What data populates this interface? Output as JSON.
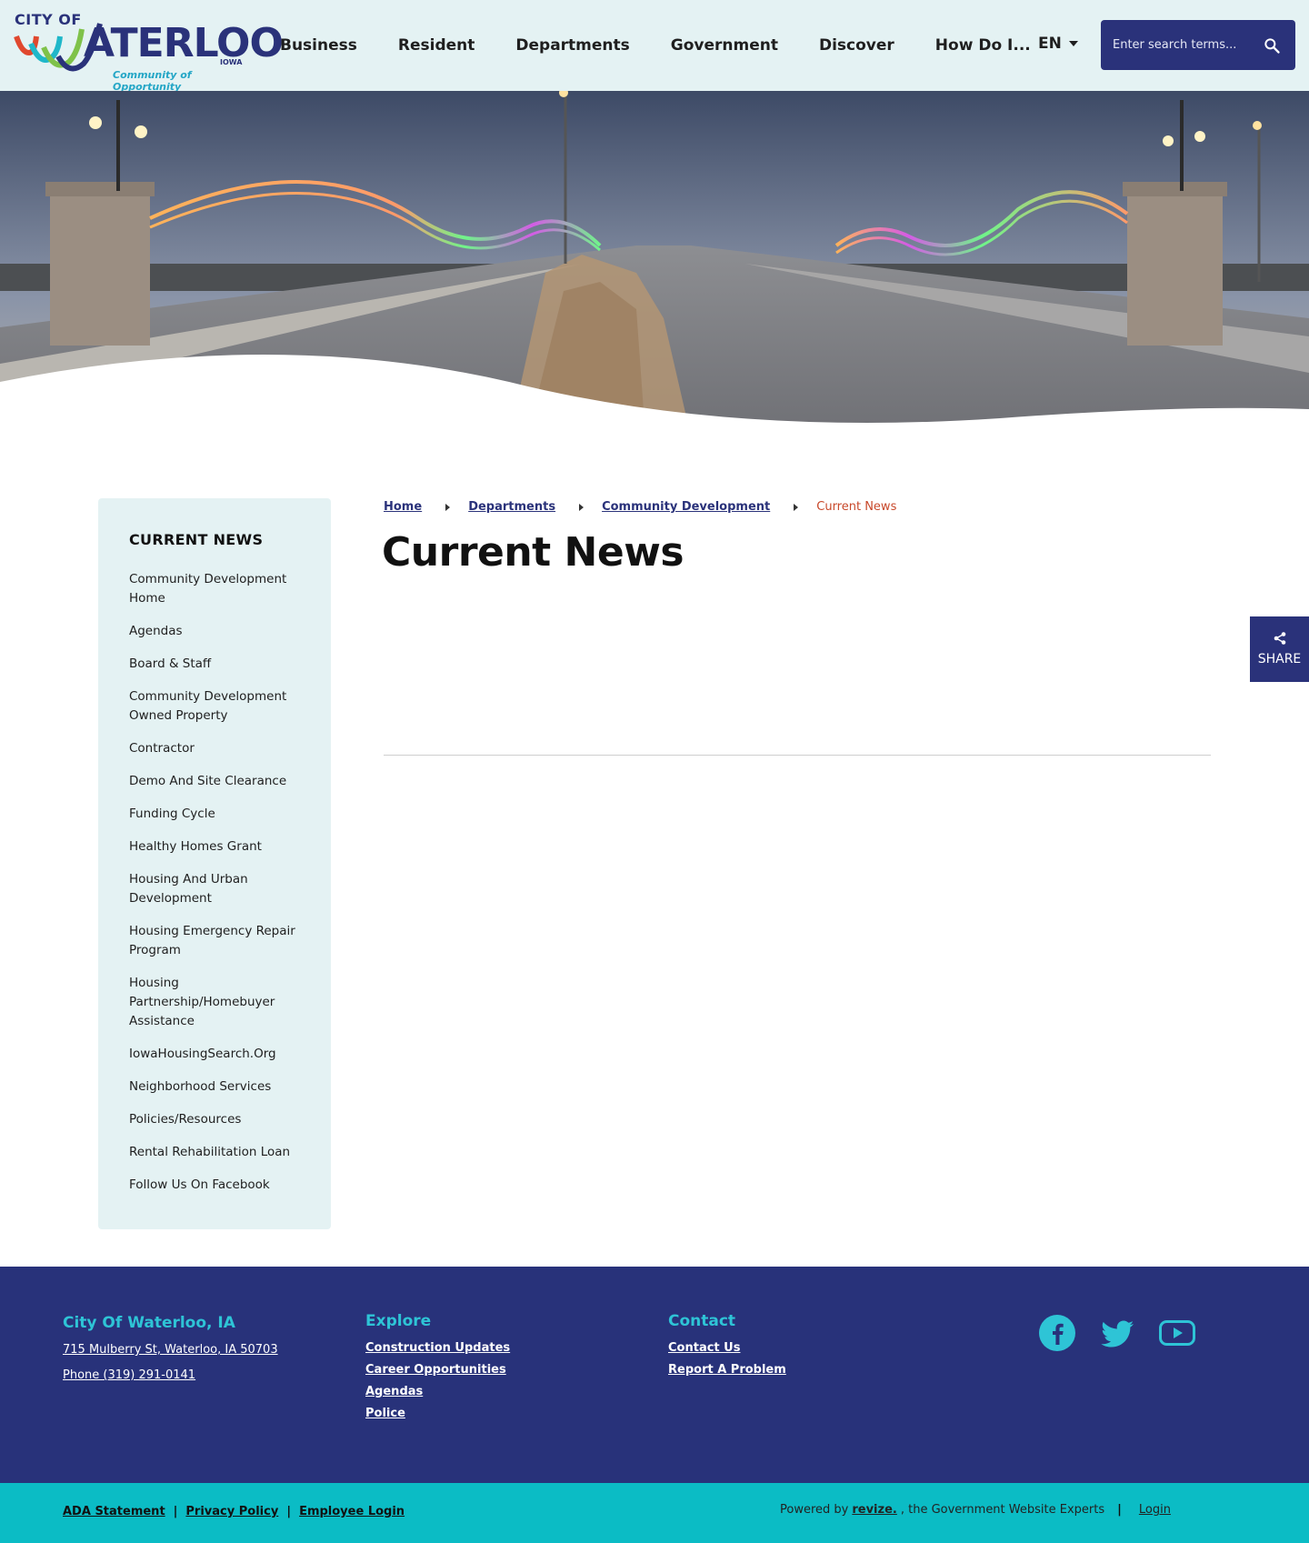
{
  "header": {
    "logo": {
      "city_of": "CITY OF",
      "word": "ATERLOO",
      "state": "IOWA",
      "tagline": "Community of Opportunity"
    },
    "nav": [
      "Business",
      "Resident",
      "Departments",
      "Government",
      "Discover",
      "How Do I..."
    ],
    "language": "EN",
    "search_placeholder": "Enter search terms...",
    "colors": {
      "header_bg": "#e4f2f3",
      "brand_navy": "#2a327a",
      "accent_teal": "#0bbcc5"
    }
  },
  "breadcrumb": {
    "links": [
      "Home",
      "Departments",
      "Community Development"
    ],
    "current": "Current News"
  },
  "page_title": "Current News",
  "sidebar": {
    "title": "CURRENT NEWS",
    "items": [
      "Community Development Home",
      "Agendas",
      "Board & Staff",
      "Community Development Owned Property",
      "Contractor",
      "Demo And Site Clearance",
      "Funding Cycle",
      "Healthy Homes Grant",
      "Housing And Urban Development",
      "Housing Emergency Repair Program",
      "Housing Partnership/Homebuyer Assistance",
      "IowaHousingSearch.Org",
      "Neighborhood Services",
      "Policies/Resources",
      "Rental Rehabilitation Loan",
      "Follow Us On Facebook"
    ]
  },
  "share": {
    "label": "SHARE",
    "icon": "share-icon"
  },
  "footer": {
    "city": {
      "title": "City Of Waterloo, IA",
      "address": "715 Mulberry St, Waterloo, IA 50703",
      "phone": "Phone (319) 291-0141"
    },
    "explore": {
      "title": "Explore",
      "links": [
        "Construction Updates",
        "Career Opportunities",
        "Agendas",
        "Police"
      ]
    },
    "contact": {
      "title": "Contact",
      "links": [
        "Contact Us",
        "Report A Problem"
      ]
    },
    "social": [
      "facebook-icon",
      "twitter-icon",
      "youtube-icon"
    ]
  },
  "subfooter": {
    "links": [
      "ADA Statement",
      "Privacy Policy",
      "Employee Login"
    ],
    "powered_prefix": "Powered by",
    "powered_brand": "revize.",
    "powered_suffix": ", the Government Website Experts",
    "login": "Login"
  }
}
